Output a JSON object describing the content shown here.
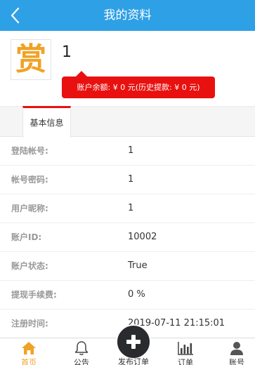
{
  "header": {
    "title": "我的资料"
  },
  "profile": {
    "avatar_char": "赏",
    "nickname": "1",
    "balance_text": "账户余额: ¥ 0 元(历史提款: ¥ 0 元)"
  },
  "tabs": [
    {
      "label": "基本信息",
      "active": true
    }
  ],
  "info": [
    {
      "label": "登陆帐号:",
      "value": "1"
    },
    {
      "label": "帐号密码:",
      "value": "1"
    },
    {
      "label": "用户昵称:",
      "value": "1"
    },
    {
      "label": "账户ID:",
      "value": "10002"
    },
    {
      "label": "账户状态:",
      "value": "True"
    },
    {
      "label": "提现手续费:",
      "value": "0 %"
    },
    {
      "label": "注册时间:",
      "value": "2019-07-11 21:15:01"
    }
  ],
  "tabbar": [
    {
      "label": "首页",
      "icon": "home-icon",
      "active": true
    },
    {
      "label": "公告",
      "icon": "bell-icon",
      "active": false
    },
    {
      "label": "发布订单",
      "icon": "plus-icon",
      "active": false
    },
    {
      "label": "订单",
      "icon": "bar-chart-icon",
      "active": false
    },
    {
      "label": "账号",
      "icon": "user-icon",
      "active": false
    }
  ],
  "colors": {
    "header_bg": "#2ea0e6",
    "accent_red": "#e8110f",
    "active_orange": "#f0a225"
  }
}
